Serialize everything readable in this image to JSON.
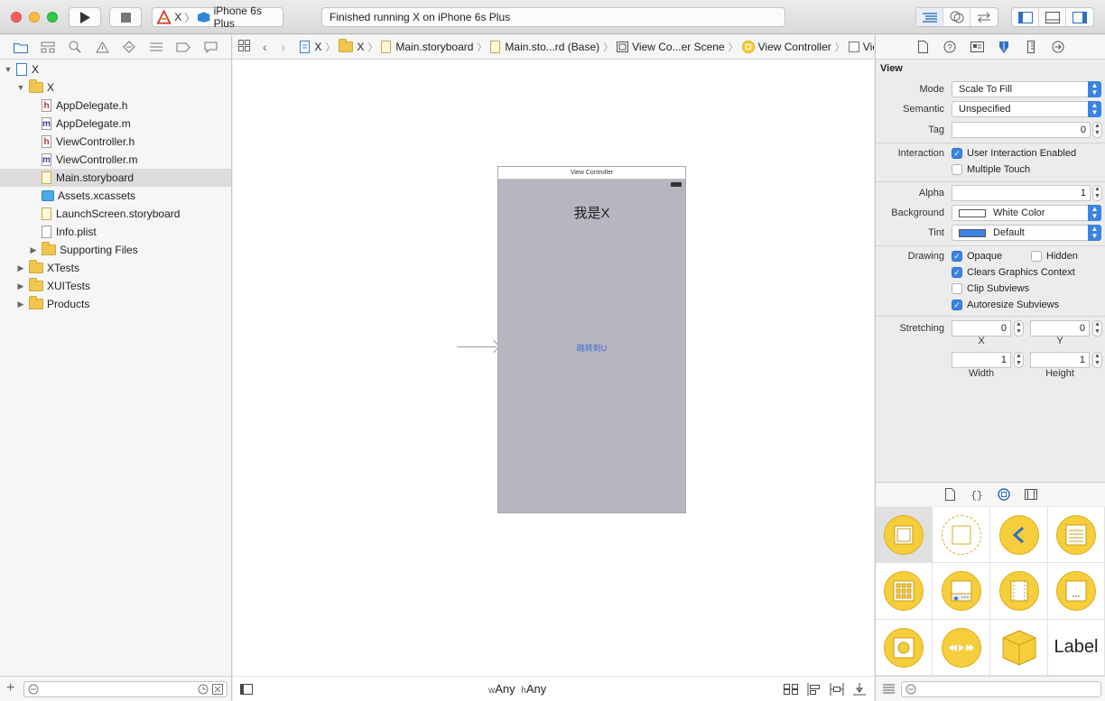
{
  "toolbar": {
    "scheme_target": "X",
    "scheme_device": "iPhone 6s Plus",
    "status_text": "Finished running X on iPhone 6s Plus"
  },
  "navigator": {
    "items": [
      {
        "label": "X",
        "kind": "project",
        "indent": 0,
        "disclosure": "▼"
      },
      {
        "label": "X",
        "kind": "folder",
        "indent": 1,
        "disclosure": "▼"
      },
      {
        "label": "AppDelegate.h",
        "kind": "h",
        "indent": 2,
        "disclosure": ""
      },
      {
        "label": "AppDelegate.m",
        "kind": "m",
        "indent": 2,
        "disclosure": ""
      },
      {
        "label": "ViewController.h",
        "kind": "h",
        "indent": 2,
        "disclosure": ""
      },
      {
        "label": "ViewController.m",
        "kind": "m",
        "indent": 2,
        "disclosure": ""
      },
      {
        "label": "Main.storyboard",
        "kind": "storyboard",
        "indent": 2,
        "disclosure": "",
        "selected": true
      },
      {
        "label": "Assets.xcassets",
        "kind": "assets",
        "indent": 2,
        "disclosure": ""
      },
      {
        "label": "LaunchScreen.storyboard",
        "kind": "storyboard",
        "indent": 2,
        "disclosure": ""
      },
      {
        "label": "Info.plist",
        "kind": "plist",
        "indent": 2,
        "disclosure": ""
      },
      {
        "label": "Supporting Files",
        "kind": "folder",
        "indent": 2,
        "disclosure": "▶"
      },
      {
        "label": "XTests",
        "kind": "folder",
        "indent": 1,
        "disclosure": "▶"
      },
      {
        "label": "XUITests",
        "kind": "folder",
        "indent": 1,
        "disclosure": "▶"
      },
      {
        "label": "Products",
        "kind": "folder",
        "indent": 1,
        "disclosure": "▶"
      }
    ]
  },
  "jumpbar": {
    "crumbs": [
      "X",
      "X",
      "Main.storyboard",
      "Main.sto...rd (Base)",
      "View Co...er Scene",
      "View Controller",
      "View"
    ]
  },
  "canvas": {
    "scene_title": "View Controller",
    "label_text": "我是X",
    "button_text": "跳转到U",
    "size_class_w_prefix": "w",
    "size_class_w": "Any",
    "size_class_h_prefix": "h",
    "size_class_h": "Any"
  },
  "inspector": {
    "section_title": "View",
    "mode_label": "Mode",
    "mode_value": "Scale To Fill",
    "semantic_label": "Semantic",
    "semantic_value": "Unspecified",
    "tag_label": "Tag",
    "tag_value": "0",
    "interaction_label": "Interaction",
    "user_interaction": "User Interaction Enabled",
    "multiple_touch": "Multiple Touch",
    "alpha_label": "Alpha",
    "alpha_value": "1",
    "background_label": "Background",
    "background_value": "White Color",
    "tint_label": "Tint",
    "tint_value": "Default",
    "tint_color": "#3a84e3",
    "drawing_label": "Drawing",
    "opaque": "Opaque",
    "hidden": "Hidden",
    "clears_graphics": "Clears Graphics Context",
    "clip_subviews": "Clip Subviews",
    "autoresize_subviews": "Autoresize Subviews",
    "stretching_label": "Stretching",
    "stretch_x": "0",
    "stretch_y": "0",
    "stretch_w": "1",
    "stretch_h": "1",
    "x_label": "X",
    "y_label": "Y",
    "width_label": "Width",
    "height_label": "Height"
  },
  "library": {
    "label_item": "Label"
  }
}
